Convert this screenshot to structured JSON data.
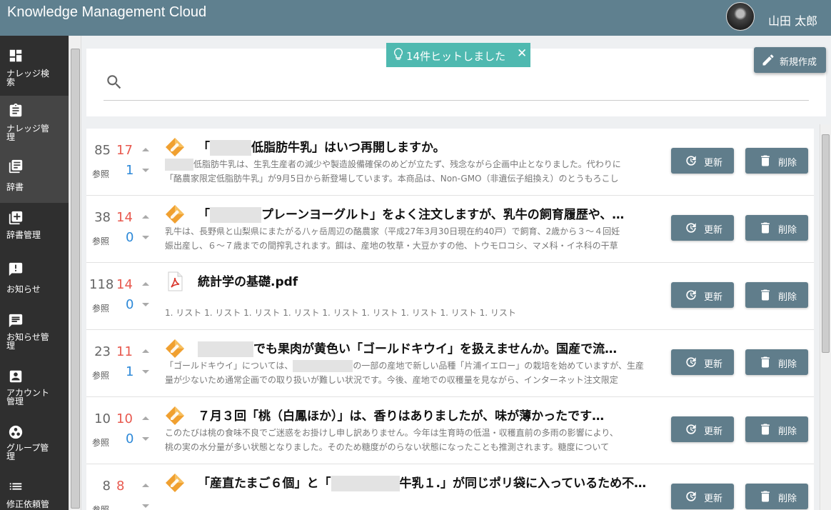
{
  "header": {
    "title": "Knowledge Management Cloud",
    "user_name": "山田 太郎"
  },
  "sidebar": {
    "items": [
      {
        "label": "ナレッジ検\n索",
        "icon": "dashboard-icon"
      },
      {
        "label": "ナレッジ管\n理",
        "icon": "clipboard-icon"
      },
      {
        "label": "辞書",
        "icon": "book-icon"
      },
      {
        "label": "辞書管理",
        "icon": "library-add-icon"
      },
      {
        "label": "お知らせ",
        "icon": "announcement-icon"
      },
      {
        "label": "お知らせ管\n理",
        "icon": "chat-icon"
      },
      {
        "label": "アカウント\n管理",
        "icon": "account-icon"
      },
      {
        "label": "グループ管\n理",
        "icon": "group-icon"
      },
      {
        "label": "修正依頼管",
        "icon": "list-icon"
      }
    ]
  },
  "toast": {
    "message": "14件ヒットしました",
    "close": "✕"
  },
  "toolbar": {
    "new_label": "新規作成"
  },
  "search": {
    "placeholder": ""
  },
  "list": {
    "ref_label": "参照",
    "update_label": "更新",
    "delete_label": "削除",
    "rows": [
      {
        "views": "85",
        "likes": "17",
        "stocks": "1",
        "icon": "knowledge-icon",
        "title_pre": "「",
        "title_post": "低脂肪牛乳」はいつ再開しますか。",
        "body1": "低脂肪牛乳は、生乳生産者の減少や製造設備確保のめどが立たず、残念ながら企画中止となりました。代わりに",
        "body2": "「酪農家限定低脂肪牛乳」が9月5日から新登場しています。本商品は、Non-GMO（非遺伝子組換え）のとうもろこし"
      },
      {
        "views": "38",
        "likes": "14",
        "stocks": "0",
        "icon": "knowledge-icon",
        "title_pre": "「",
        "title_post": "プレーンヨーグルト」をよく注文しますが、乳牛の飼育履歴や、…",
        "body1": "乳牛は、長野県と山梨県にまたがる八ヶ岳周辺の酪農家（平成27年3月30日現在約40戸）で飼育、2歳から３～４回妊",
        "body2": "娠出産し、６～７歳までの間搾乳されます。餌は、産地の牧草・大豆かすの他、トウモロコシ、マメ科・イネ科の干草"
      },
      {
        "views": "118",
        "likes": "14",
        "stocks": "0",
        "icon": "pdf-icon",
        "title_pre": "",
        "title_post": "統計学の基礎.pdf",
        "body1": "",
        "body2": "1. リスト 1. リスト 1. リスト 1. リスト 1. リスト 1. リスト 1. リスト 1. リスト 1. リスト"
      },
      {
        "views": "23",
        "likes": "11",
        "stocks": "1",
        "icon": "knowledge-icon",
        "title_pre": "",
        "title_post": "でも果肉が黄色い「ゴールドキウイ」を扱えませんか。国産で流…",
        "body1": "「ゴールドキウイ」については、",
        "body1b": "の一部の産地で新しい品種「片浦イエロー」の栽培を始めていますが、生産",
        "body2": "量が少ないため通常企画での取り扱いが難しい状況です。今後、産地での収穫量を見ながら、インターネット注文限定"
      },
      {
        "views": "10",
        "likes": "10",
        "stocks": "0",
        "icon": "knowledge-icon",
        "title_pre": "",
        "title_post": "７月３回「桃（白鳳ほか）」は、香りはありましたが、味が薄かったです…",
        "body1": "このたびは桃の食味不良でご迷惑をお掛けし申し訳ありません。今年は生育時の低温・収穫直前の多雨の影響により、",
        "body2": "桃の実の水分量が多い状態となりました。そのため糖度がのらない状態になったことも推測されます。糖度について"
      },
      {
        "views": "8",
        "likes": "8",
        "stocks": "",
        "icon": "knowledge-icon",
        "title_pre": "「産直たまご６個」と「",
        "title_post": "牛乳１.」が同じポリ袋に入っているため不…",
        "body1": "",
        "body2": ""
      }
    ]
  }
}
